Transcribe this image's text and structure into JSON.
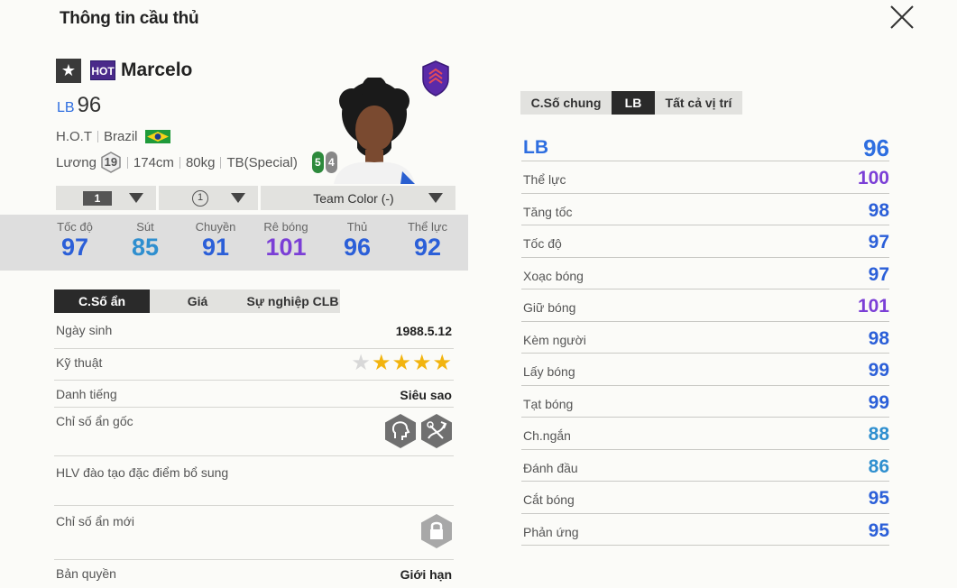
{
  "header": {
    "title": "Thông tin cầu thủ"
  },
  "icons": {
    "close": "close-icon",
    "star": "star-icon",
    "club": "shield-icon"
  },
  "player": {
    "star": "★",
    "season_badge": "HOT",
    "name": "Marcelo",
    "position": "LB",
    "overall": "96",
    "season": "H.O.T",
    "nationality": "Brazil",
    "salary_label": "Lương",
    "salary": "19",
    "height": "174cm",
    "weight": "80kg",
    "body_type": "TB(Special)",
    "strong_foot": "5",
    "weak_foot": "4"
  },
  "selectors": {
    "level": "1",
    "upgrade": "1",
    "team_color": "Team Color (-)"
  },
  "main_stats": [
    {
      "label": "Tốc độ",
      "value": "97",
      "color": "#2b5fd8"
    },
    {
      "label": "Sút",
      "value": "85",
      "color": "#2f8fcf"
    },
    {
      "label": "Chuyền",
      "value": "91",
      "color": "#2b5fd8"
    },
    {
      "label": "Rê bóng",
      "value": "101",
      "color": "#7b3fd6"
    },
    {
      "label": "Thủ",
      "value": "96",
      "color": "#2b5fd8"
    },
    {
      "label": "Thể lực",
      "value": "92",
      "color": "#2b5fd8"
    }
  ],
  "left_tabs": [
    "C.Số ẩn",
    "Giá",
    "Sự nghiệp CLB"
  ],
  "info": {
    "birth_label": "Ngày sinh",
    "birth_value": "1988.5.12",
    "skill_label": "Kỹ thuật",
    "skill_stars": 4,
    "rep_label": "Danh tiếng",
    "rep_value": "Siêu sao",
    "traits_label": "Chỉ số ẩn gốc",
    "coach_label": "HLV đào tạo đặc điểm bổ sung",
    "new_traits_label": "Chỉ số ẩn mới",
    "license_label": "Bản quyền",
    "license_value": "Giới hạn"
  },
  "right_tabs": [
    "C.Số chung",
    "LB",
    "Tất cả vị trí"
  ],
  "position_header": {
    "label": "LB",
    "value": "96"
  },
  "position_stats": [
    {
      "label": "Thể lực",
      "value": "100",
      "color": "#7b3fd6"
    },
    {
      "label": "Tăng tốc",
      "value": "98",
      "color": "#2b5fd8"
    },
    {
      "label": "Tốc độ",
      "value": "97",
      "color": "#2b5fd8"
    },
    {
      "label": "Xoạc bóng",
      "value": "97",
      "color": "#2b5fd8"
    },
    {
      "label": "Giữ bóng",
      "value": "101",
      "color": "#7b3fd6"
    },
    {
      "label": "Kèm người",
      "value": "98",
      "color": "#2b5fd8"
    },
    {
      "label": "Lấy bóng",
      "value": "99",
      "color": "#2b5fd8"
    },
    {
      "label": "Tạt bóng",
      "value": "99",
      "color": "#2b5fd8"
    },
    {
      "label": "Ch.ngắn",
      "value": "88",
      "color": "#2f8fcf"
    },
    {
      "label": "Đánh đầu",
      "value": "86",
      "color": "#2f8fcf"
    },
    {
      "label": "Cắt bóng",
      "value": "95",
      "color": "#2b5fd8"
    },
    {
      "label": "Phản ứng",
      "value": "95",
      "color": "#2b5fd8"
    }
  ]
}
